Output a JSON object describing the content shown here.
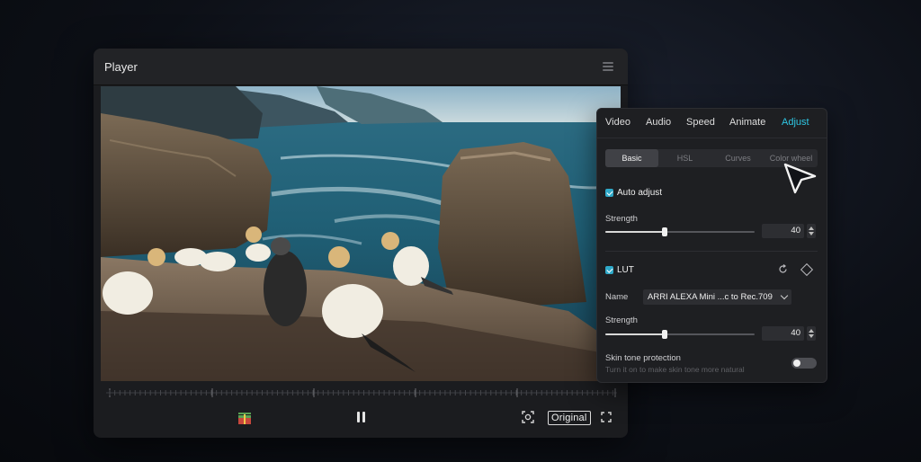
{
  "player": {
    "title": "Player",
    "original_label": "Original",
    "icons": [
      "menu-icon",
      "gift-icon",
      "pause-icon",
      "focus-icon",
      "fullscreen-icon"
    ]
  },
  "adjust_panel": {
    "tabs": [
      "Video",
      "Audio",
      "Speed",
      "Animate",
      "Adjust"
    ],
    "active_tab": "Adjust",
    "subtabs": [
      "Basic",
      "HSL",
      "Curves",
      "Color wheel"
    ],
    "active_subtab": "Basic",
    "auto_adjust": {
      "label": "Auto adjust",
      "checked": true,
      "strength_label": "Strength",
      "strength_value": "40"
    },
    "lut": {
      "label": "LUT",
      "checked": true,
      "name_label": "Name",
      "name_value": "ARRI ALEXA Mini ...c to Rec.709",
      "strength_label": "Strength",
      "strength_value": "40"
    },
    "skin_tone": {
      "label": "Skin tone protection",
      "hint": "Turn it on to make skin tone more natural",
      "enabled": false
    }
  },
  "colors": {
    "accent": "#2ec7e4",
    "checkbox": "#2fa9c9",
    "panel_bg": "#1e1f22",
    "player_bg": "#1b1c1f"
  }
}
